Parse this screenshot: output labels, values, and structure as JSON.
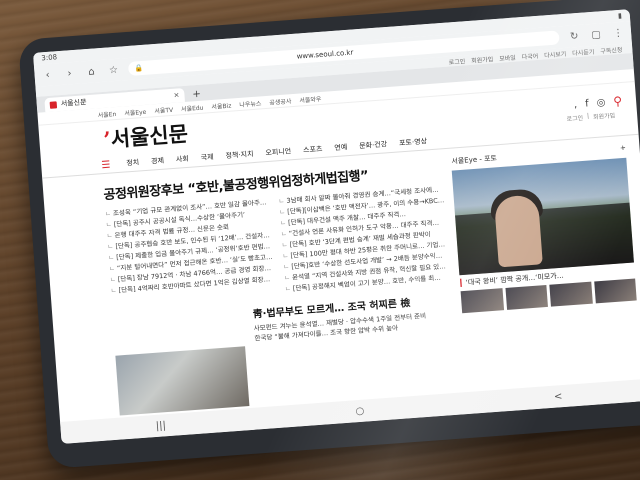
{
  "status_bar": {
    "time": "3:08"
  },
  "browser": {
    "url": "www.seoul.co.kr",
    "links": [
      "로그인",
      "회원가입",
      "모바일",
      "다국어",
      "다시보기",
      "다시듣기",
      "구독신청"
    ],
    "tab": {
      "title": "서울신문"
    }
  },
  "site": {
    "top_nav": [
      "서울En",
      "서울Eye",
      "서울TV",
      "서울Edu",
      "서울Biz",
      "나우뉴스",
      "공생공사",
      "서울와우"
    ],
    "logo": "서울신문",
    "login_row": [
      "로그인",
      "회원가입"
    ],
    "gnb": [
      "정치",
      "경제",
      "사회",
      "국제",
      "정책·지치",
      "오피니언",
      "스포츠",
      "연예",
      "문화·건강",
      "포토·영상"
    ],
    "main": {
      "headline": "공정위원장후보 “호반,불공정행위엄정하게법집행”",
      "left_news": [
        "조성욱 “기업 규모 관계없이 조사”… 호반 일감 몰아주…",
        "[단독] 공주시 공공시설 독식…수상한 ‘몰아주기’",
        "은행 대주주 자격 법률 규정… 신문은 숫뢰",
        "[단독] 공주협승 호반 보도, 인수된 뒤 ‘12배’… 건설자…",
        "[단독] 제출한 입금 몰아주기 규제… ‘공정위’호반 편법…",
        "“지분 털어내면다” 먼저 접근해온 호반… ‘실’도 빵초고…",
        "[단독] 장남 7912억 · 차남 4766억… 공급 경영 회장…",
        "[단독] 4억짜리 호반아파트 샀다면 1억은 김상열 회장…"
      ],
      "right_news": [
        "3남매 회사 알짜 몰아줘 경영권 승계…“국세청 조사에…",
        "[단독][이삼백은 ‘호반 맥전자’… 광주, 이의 수용→KBC…",
        "[단독] 대우건설 맥주 개찰… 대주주 직격…",
        "“건설사 언론 사유화 인허가 도구 악용… 대주주 직격…",
        "[단독] 호반 ‘3단계 편법 승계’ 재벌 세습과정 판박이",
        "[단독] 100만 평대 하반 25평은 취한 주머니로… 기업…",
        "[단독]호반 ‘수상한 선도사업 개발’ → 2배듬 분양수익…",
        "윤석열 “지역 건설사와 지방 권점 유착, 혁신할 필요 있…",
        "[단독] 공정해지 벡엄이 고기 분양… 호반, 수익률 최…"
      ],
      "sub_headline": "靑·법무부도 모르게… 조국 허찌른 檢",
      "sub_news": [
        "사모펀드 겨누는 윤석열… 재벌당 · 압수수색 1주일 전부터 준비",
        "한국당 “불해 가져다이를… 조국 향한 압박 수위 높아"
      ]
    },
    "side": {
      "section_title": "서울Eye - 포토",
      "more": "+",
      "caption": "‘대국 왕비’ 깜짝 공개…‘미모가…"
    }
  },
  "navbar": [
    "|||",
    "○",
    "<"
  ]
}
